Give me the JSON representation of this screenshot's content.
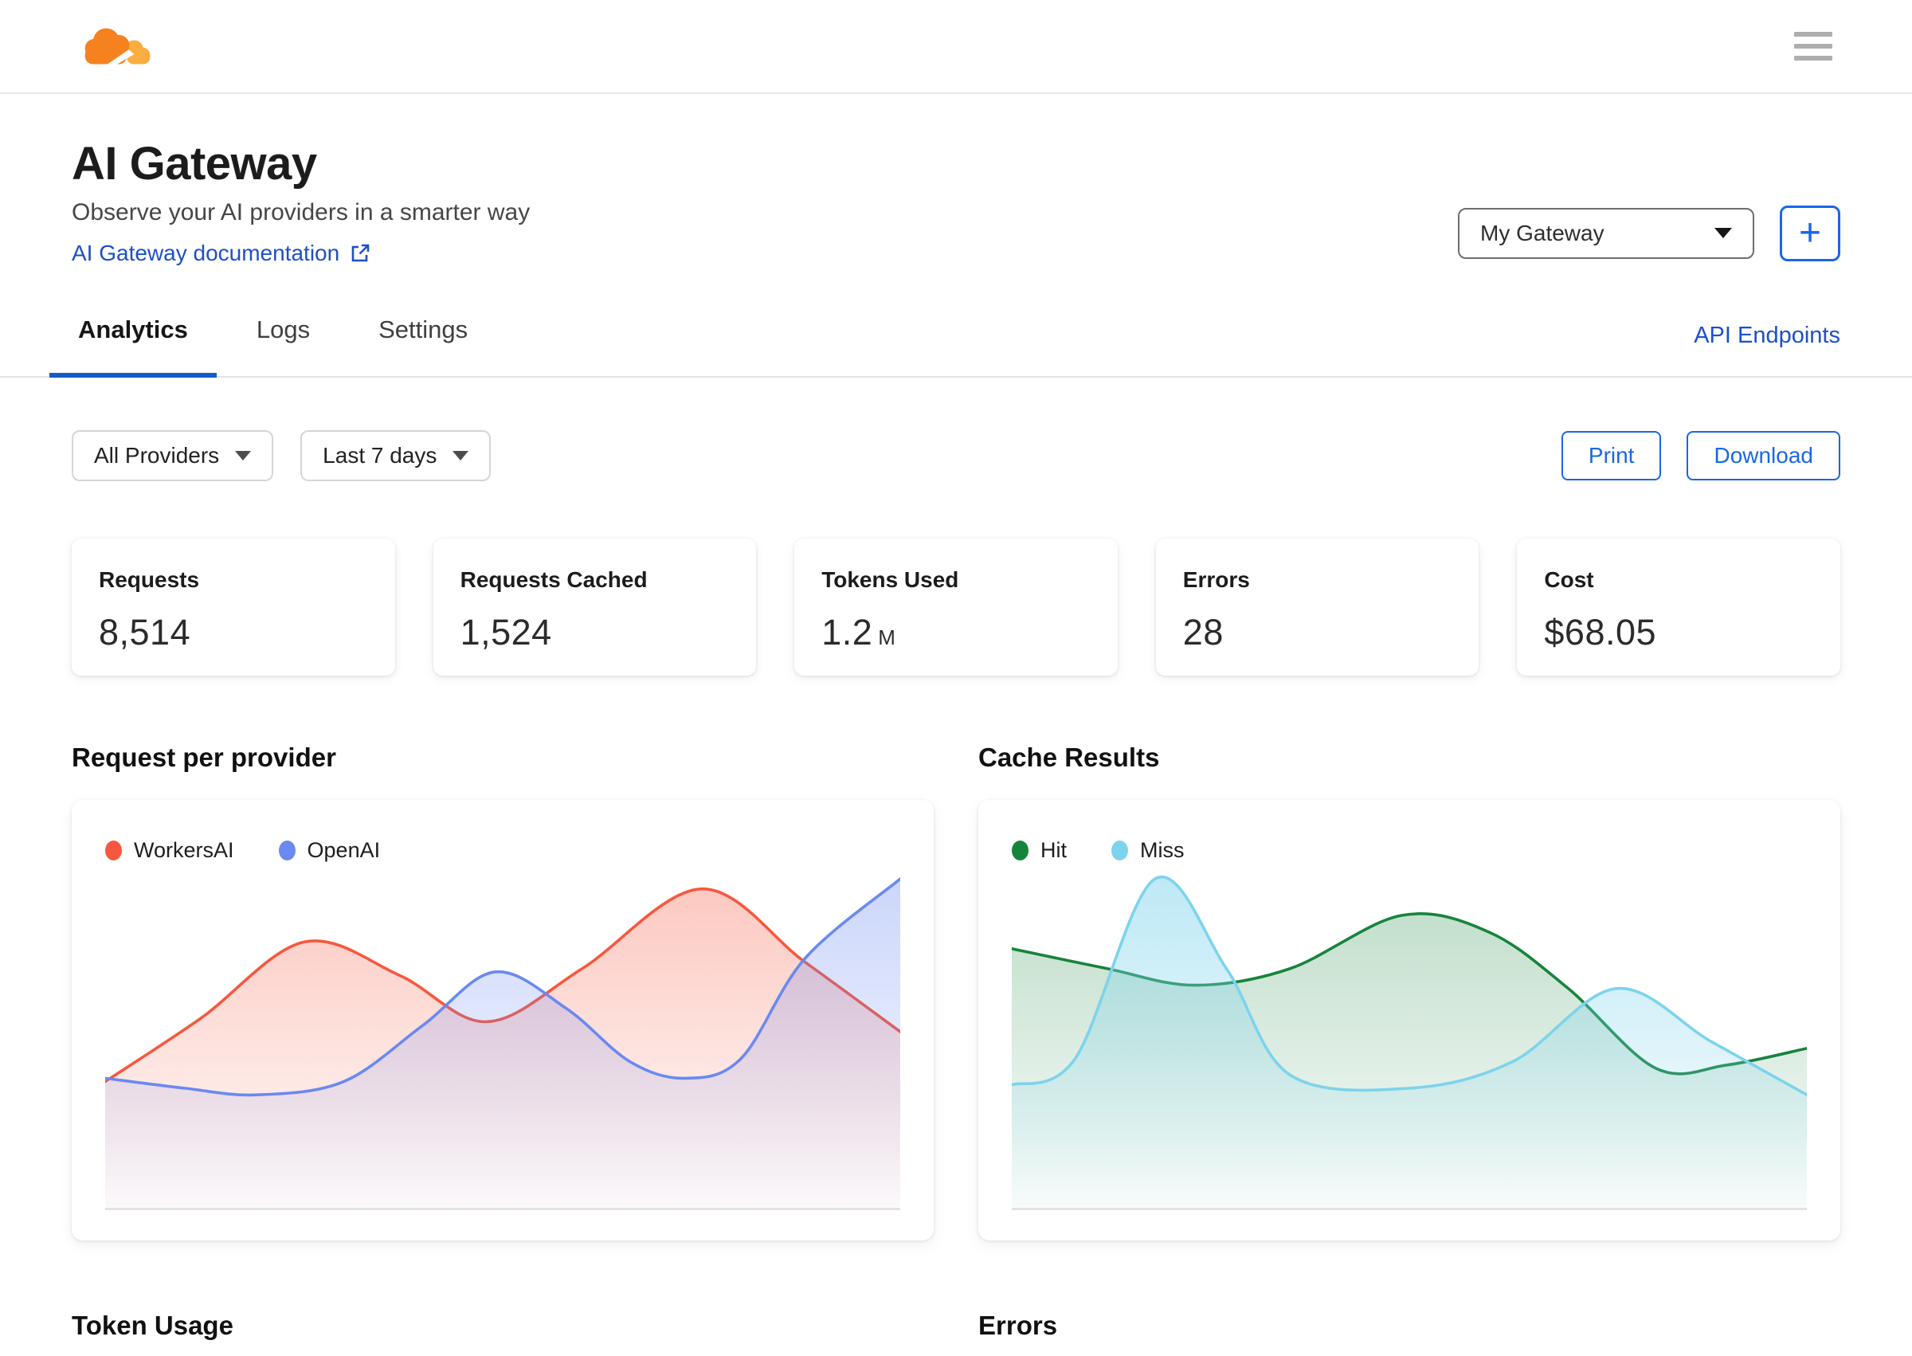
{
  "header": {
    "logo_name": "cloudflare-logo",
    "logo_colors": {
      "cloud_main": "#F6821F",
      "cloud_light": "#FBAD41"
    }
  },
  "page_header": {
    "title": "AI Gateway",
    "subtitle": "Observe your AI providers in a smarter way",
    "doc_link_label": "AI Gateway documentation",
    "gateway_selector_value": "My Gateway",
    "add_gateway_label": "+"
  },
  "tabs": {
    "items": [
      {
        "label": "Analytics",
        "active": true
      },
      {
        "label": "Logs",
        "active": false
      },
      {
        "label": "Settings",
        "active": false
      }
    ],
    "api_endpoints_label": "API Endpoints"
  },
  "toolbar": {
    "provider_filter_value": "All Providers",
    "date_range_value": "Last 7 days",
    "print_label": "Print",
    "download_label": "Download"
  },
  "stats": [
    {
      "label": "Requests",
      "value": "8,514",
      "unit": ""
    },
    {
      "label": "Requests Cached",
      "value": "1,524",
      "unit": ""
    },
    {
      "label": "Tokens Used",
      "value": "1.2",
      "unit": "M"
    },
    {
      "label": "Errors",
      "value": "28",
      "unit": ""
    },
    {
      "label": "Cost",
      "value": "$68.05",
      "unit": ""
    }
  ],
  "sections": {
    "request_per_provider": "Request per provider",
    "cache_results": "Cache Results",
    "token_usage": "Token Usage",
    "errors": "Errors"
  },
  "theme": {
    "link_blue": "#1D4FC7",
    "button_blue": "#1A66E8",
    "tab_underline_blue": "#155BCA",
    "border_gray": "#E4E4E4"
  },
  "chart_data": [
    {
      "type": "area",
      "title": "Request per provider",
      "legend_position": "top-left",
      "grid": false,
      "axes_note": "no axis labels or ticks shown; points given as [x % of plot width, y % of plot height above baseline]",
      "series": [
        {
          "name": "WorkersAI",
          "color": "#F6583E",
          "fill_opacity": 0.32,
          "points": [
            [
              0,
              38
            ],
            [
              12,
              57
            ],
            [
              25,
              80
            ],
            [
              37,
              70
            ],
            [
              48,
              56
            ],
            [
              60,
              72
            ],
            [
              75,
              96
            ],
            [
              88,
              74
            ],
            [
              100,
              53
            ]
          ]
        },
        {
          "name": "OpenAI",
          "color": "#6A89F1",
          "fill_opacity": 0.35,
          "points": [
            [
              0,
              39
            ],
            [
              10,
              36
            ],
            [
              19,
              34
            ],
            [
              30,
              38
            ],
            [
              40,
              55
            ],
            [
              49,
              71
            ],
            [
              58,
              60
            ],
            [
              66,
              44
            ],
            [
              73,
              39
            ],
            [
              80,
              45
            ],
            [
              88,
              75
            ],
            [
              100,
              99
            ]
          ]
        }
      ]
    },
    {
      "type": "area",
      "title": "Cache Results",
      "legend_position": "top-left",
      "grid": false,
      "axes_note": "no axis labels or ticks shown; points given as [x % of plot width, y % of plot height above baseline]",
      "series": [
        {
          "name": "Hit",
          "color": "#17843C",
          "fill_opacity": 0.26,
          "points": [
            [
              0,
              78
            ],
            [
              12,
              72
            ],
            [
              23,
              67
            ],
            [
              35,
              72
            ],
            [
              49,
              88
            ],
            [
              60,
              83
            ],
            [
              70,
              66
            ],
            [
              81,
              42
            ],
            [
              90,
              43
            ],
            [
              100,
              48
            ]
          ]
        },
        {
          "name": "Miss",
          "color": "#7DD3EC",
          "fill_opacity": 0.5,
          "points": [
            [
              0,
              37
            ],
            [
              8,
              45
            ],
            [
              18,
              99
            ],
            [
              27,
              72
            ],
            [
              35,
              40
            ],
            [
              50,
              36
            ],
            [
              63,
              44
            ],
            [
              76,
              66
            ],
            [
              88,
              50
            ],
            [
              100,
              34
            ]
          ]
        }
      ]
    }
  ]
}
